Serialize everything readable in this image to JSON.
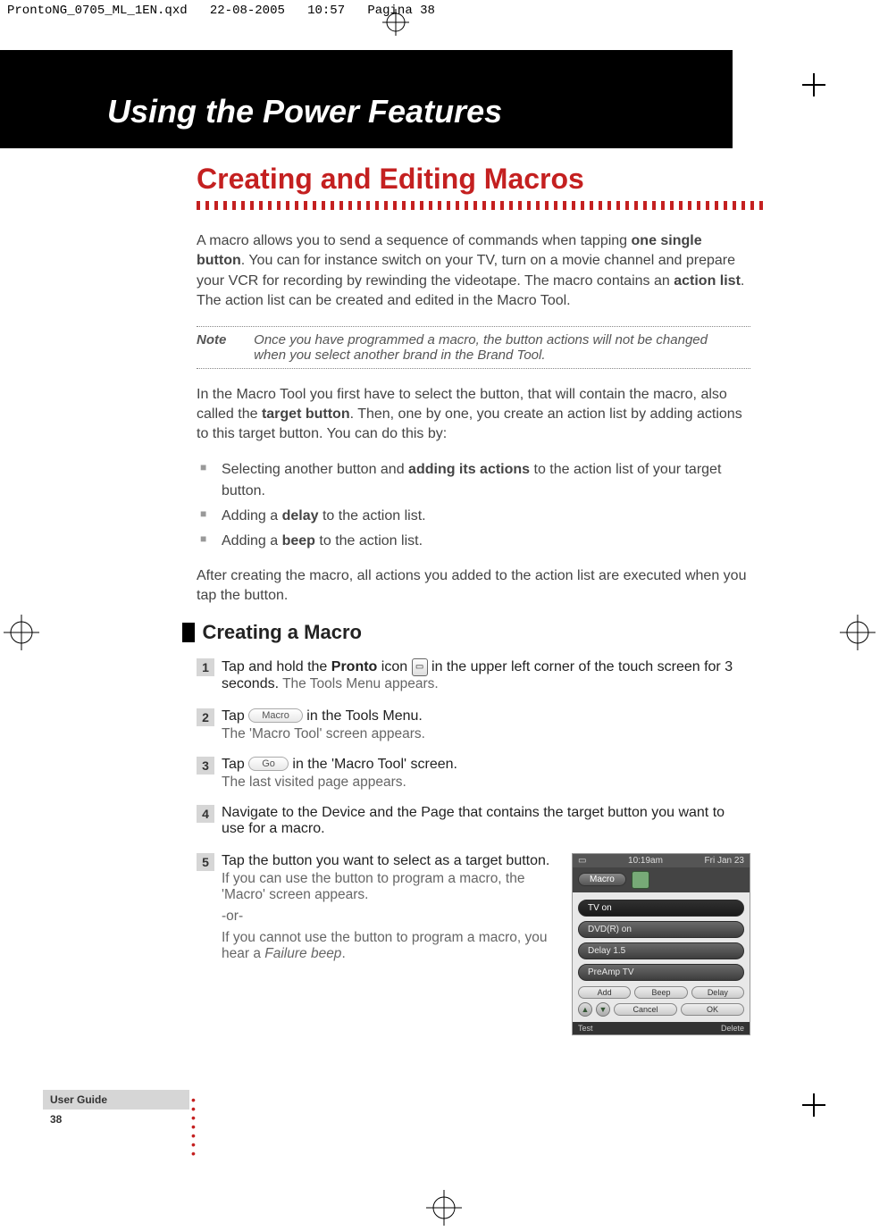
{
  "meta": {
    "file": "ProntoNG_0705_ML_1EN.qxd",
    "date": "22-08-2005",
    "time": "10:57",
    "pagina": "Pagina 38"
  },
  "chapter_title": "Using the Power Features",
  "section_title": "Creating and Editing Macros",
  "intro": "A macro allows you to send a sequence of commands when tapping one single button. You can for instance switch on your TV, turn on a movie channel and prepare your VCR for recording by rewinding the videotape. The macro contains an action list. The action list can be created and edited in the Macro Tool.",
  "intro_parts": {
    "p1": "A macro allows you to send a sequence of commands when tapping ",
    "b1": "one single button",
    "p2": ". You can for instance switch on your TV, turn on a movie channel and prepare your VCR for recording by rewinding the videotape. The macro contains an ",
    "b2": "action list",
    "p3": ". The action list can be created and edited in the Macro Tool."
  },
  "note": {
    "label": "Note",
    "text": "Once you have programmed a macro, the button actions will not be changed when you select another brand in the Brand Tool."
  },
  "para2_parts": {
    "p1": "In the Macro Tool you first have to select the button, that will contain the macro, also called the ",
    "b1": "target button",
    "p2": ". Then, one by one, you create an action list by adding actions to this target button. You can do this by:"
  },
  "bullets": {
    "b0a": "Selecting another button and ",
    "b0b": "adding its actions",
    "b0c": " to the action list of your target button.",
    "b1a": "Adding a ",
    "b1b": "delay",
    "b1c": " to the action list.",
    "b2a": "Adding a ",
    "b2b": "beep",
    "b2c": " to the action list."
  },
  "para3": "After creating the macro, all actions you added to the action list are executed when you tap the button.",
  "subhead": "Creating a Macro",
  "steps": {
    "s1": {
      "num": "1",
      "t1a": "Tap and hold the ",
      "t1b": "Pronto",
      "t1c": " icon ",
      "t1d": " in the upper left corner of the touch screen for 3 seconds.",
      "sub": " The Tools Menu appears."
    },
    "s2": {
      "num": "2",
      "t1a": "Tap ",
      "btn": "Macro",
      "t1b": " in the Tools Menu.",
      "sub": "The 'Macro Tool' screen appears."
    },
    "s3": {
      "num": "3",
      "t1a": "Tap ",
      "btn": "Go",
      "t1b": " in the 'Macro Tool' screen.",
      "sub": "The last visited page appears."
    },
    "s4": {
      "num": "4",
      "t1": "Navigate to the Device and the Page that contains the target button you want to use for a macro."
    },
    "s5": {
      "num": "5",
      "t1": "Tap the button you want to select as a target button.",
      "sub1": "If you can use the button to program a macro, the 'Macro' screen appears.",
      "or": "-or-",
      "sub2a": "If you cannot use the button to program a macro, you hear a ",
      "sub2b": "Failure beep",
      "sub2c": "."
    }
  },
  "device": {
    "time": "10:19am",
    "day": "Fri Jan 23",
    "title": "Macro",
    "rows": [
      "TV on",
      "DVD(R) on",
      "Delay 1.5",
      "PreAmp TV"
    ],
    "btns": [
      "Add",
      "Beep",
      "Delay"
    ],
    "btns2": [
      "Cancel",
      "OK"
    ],
    "foot_l": "Test",
    "foot_r": "Delete"
  },
  "footer": {
    "ug": "User Guide",
    "page": "38"
  }
}
